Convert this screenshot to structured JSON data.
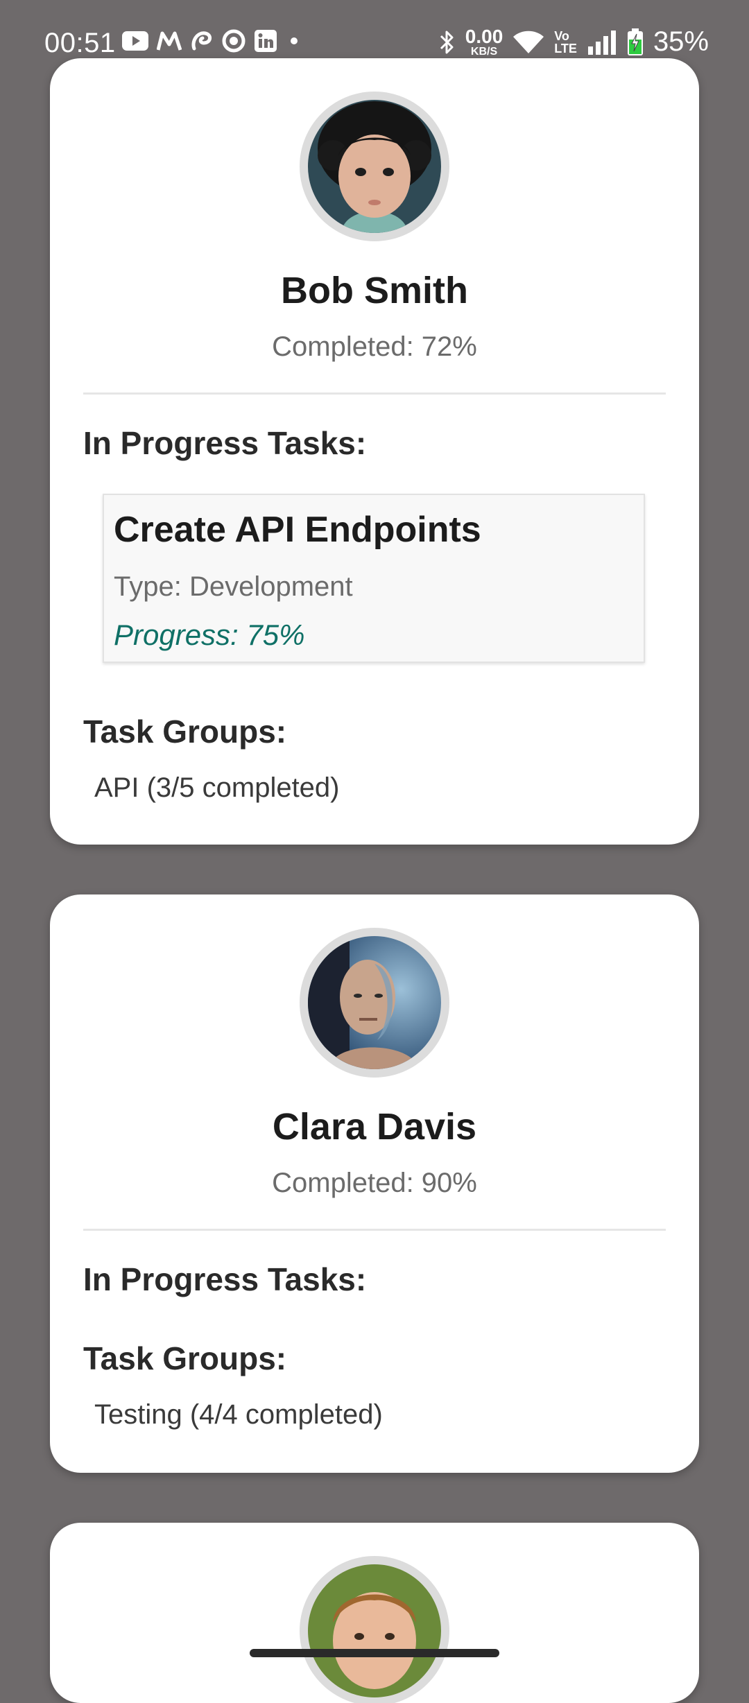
{
  "status_bar": {
    "time": "00:51",
    "net_speed_value": "0.00",
    "net_speed_unit": "KB/S",
    "volte_top": "Vo",
    "volte_bottom": "LTE",
    "battery": "35%",
    "left_icons": [
      "youtube-icon",
      "m-app-icon",
      "airtel-icon",
      "circle-app-icon",
      "linkedin-icon",
      "dot-icon"
    ],
    "right_icons": [
      "bluetooth-icon",
      "wifi-icon",
      "signal-icon",
      "battery-charging-icon"
    ]
  },
  "labels": {
    "in_progress": "In Progress Tasks:",
    "task_groups": "Task Groups:"
  },
  "members": [
    {
      "name": "Bob Smith",
      "completed": "Completed: 72%",
      "tasks": [
        {
          "title": "Create API Endpoints",
          "type": "Type: Development",
          "progress": "Progress: 75%"
        }
      ],
      "groups": [
        "API (3/5 completed)"
      ]
    },
    {
      "name": "Clara Davis",
      "completed": "Completed: 90%",
      "tasks": [],
      "groups": [
        "Testing (4/4 completed)"
      ]
    },
    {
      "name": "",
      "completed": ""
    }
  ],
  "colors": {
    "background": "#6e6a6b",
    "card": "#ffffff",
    "progress_accent": "#0f7066",
    "battery_charging": "#2ecc40"
  }
}
